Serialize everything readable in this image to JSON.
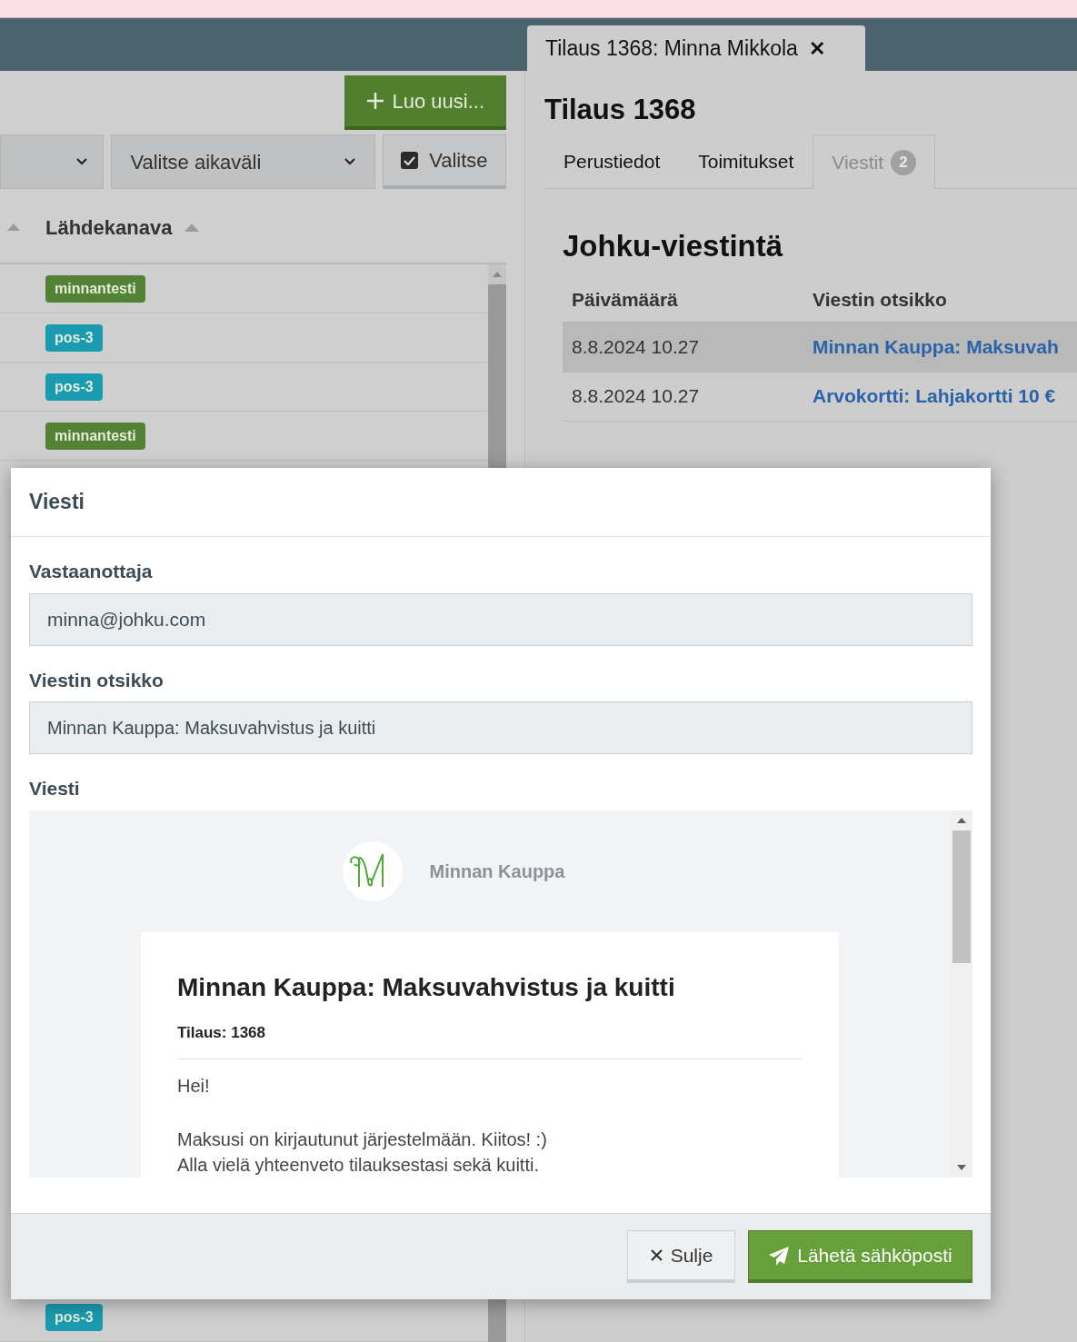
{
  "header_tab": {
    "label": "Tilaus 1368: Minna Mikkola",
    "close": "✕"
  },
  "left": {
    "create_button": "Luo uusi...",
    "filter_2": {
      "value": "Valitse aikaväli"
    },
    "select_button": {
      "label": "Valitse",
      "checked": true
    },
    "column": "Lähdekanava",
    "rows": [
      {
        "tag": "minnantesti",
        "color": "#538135"
      },
      {
        "tag": "pos-3",
        "color": "#1a9bb0"
      },
      {
        "tag": "pos-3",
        "color": "#1a9bb0"
      },
      {
        "tag": "minnantesti",
        "color": "#538135"
      }
    ],
    "bottom_row": {
      "tag": "pos-3",
      "color": "#1a9bb0"
    }
  },
  "order": {
    "title": "Tilaus 1368",
    "tabs": [
      {
        "label": "Perustiedot",
        "selected": false
      },
      {
        "label": "Toimitukset",
        "selected": false
      },
      {
        "label": "Viestit",
        "badge": "2",
        "selected": true
      }
    ],
    "section_title": "Johku-viestintä",
    "columns": [
      "Päivämäärä",
      "Viestin otsikko"
    ],
    "messages": [
      {
        "date": "8.8.2024 10.27",
        "subject": "Minnan Kauppa: Maksuvah",
        "selected": true
      },
      {
        "date": "8.8.2024 10.27",
        "subject": "Arvokortti: Lahjakortti 10 €",
        "selected": false
      }
    ]
  },
  "dialog": {
    "title": "Viesti",
    "recipient_label": "Vastaanottaja",
    "recipient": "minna@johku.com",
    "subject_label": "Viestin otsikko",
    "subject": "Minnan Kauppa: Maksuvahvistus ja kuitti",
    "message_label": "Viesti",
    "email": {
      "shop_name": "Minnan Kauppa",
      "heading": "Minnan Kauppa: Maksuvahvistus ja kuitti",
      "order_line": "Tilaus: 1368",
      "greeting": "Hei!",
      "lines": [
        "Maksusi on kirjautunut järjestelmään. Kiitos! :)",
        "Alla vielä yhteenveto tilauksestasi sekä kuitti."
      ]
    },
    "close_button": "Sulje",
    "send_button": "Lähetä sähköposti"
  }
}
